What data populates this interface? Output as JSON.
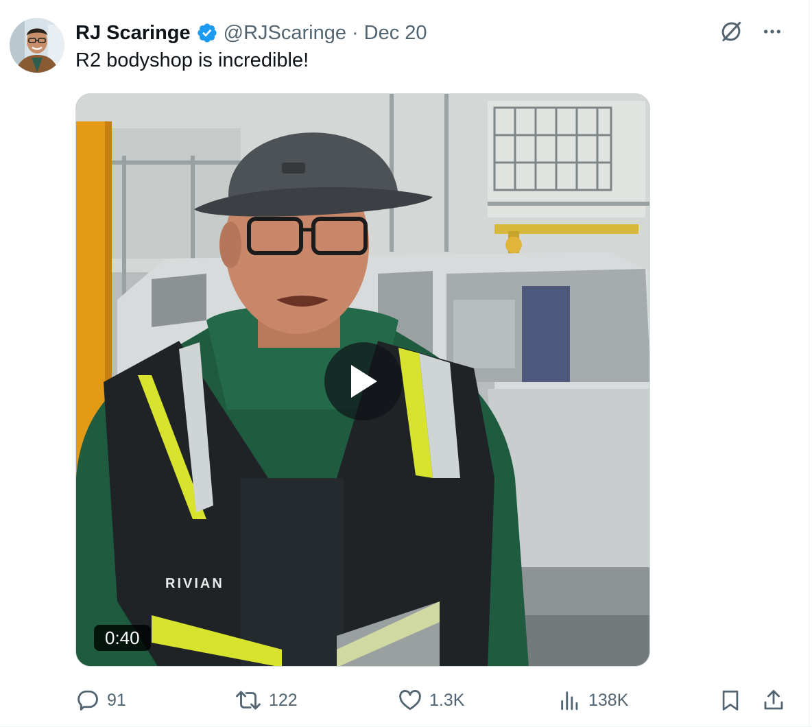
{
  "tweet": {
    "author": {
      "display_name": "RJ Scaringe",
      "handle": "@RJScaringe",
      "verified": true
    },
    "separator": "·",
    "date": "Dec 20",
    "text": "R2 bodyshop is incredible!",
    "media": {
      "type": "video",
      "duration": "0:40",
      "vest_logo": "RIVIAN"
    },
    "metrics": {
      "replies": "91",
      "reposts": "122",
      "likes": "1.3K",
      "views": "138K"
    }
  },
  "icons": {
    "verified": "verified-badge-icon",
    "grok": "grok-icon",
    "more": "more-icon",
    "play": "play-icon",
    "reply": "reply-icon",
    "repost": "repost-icon",
    "like": "like-icon",
    "views": "views-icon",
    "bookmark": "bookmark-icon",
    "share": "share-icon"
  },
  "colors": {
    "text_primary": "#0f1419",
    "text_secondary": "#536471",
    "verified_blue": "#1d9bf0",
    "border": "#cfd9de"
  }
}
